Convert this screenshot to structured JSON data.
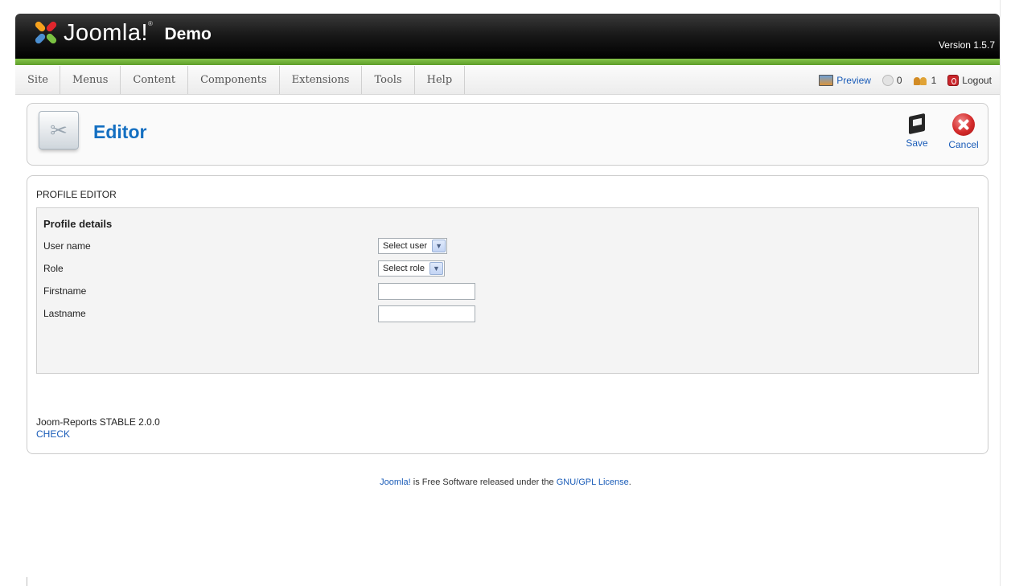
{
  "header": {
    "brand": "Joomla!",
    "brand_tm": "®",
    "site_name": "Demo",
    "version": "Version 1.5.7"
  },
  "menu": {
    "items": [
      {
        "label": "Site"
      },
      {
        "label": "Menus"
      },
      {
        "label": "Content"
      },
      {
        "label": "Components"
      },
      {
        "label": "Extensions"
      },
      {
        "label": "Tools"
      },
      {
        "label": "Help"
      }
    ]
  },
  "status": {
    "preview_label": "Preview",
    "messages_count": "0",
    "users_count": "1",
    "logout_label": "Logout"
  },
  "toolbar": {
    "title": "Editor",
    "save_label": "Save",
    "cancel_label": "Cancel"
  },
  "content": {
    "section_title": "PROFILE EDITOR",
    "fieldset_legend": "Profile details",
    "fields": {
      "username_label": "User name",
      "username_value": "Select user",
      "role_label": "Role",
      "role_value": "Select role",
      "firstname_label": "Firstname",
      "firstname_value": "",
      "lastname_label": "Lastname",
      "lastname_value": ""
    },
    "version_info": "Joom-Reports STABLE 2.0.0",
    "check_link": "CHECK"
  },
  "footer": {
    "joomla_link": "Joomla!",
    "text_middle": " is Free Software released under the ",
    "license_link": "GNU/GPL License",
    "text_end": "."
  },
  "colors": {
    "accent_blue": "#146fc1",
    "header_green": "#86c44a",
    "header_black": "#000000"
  }
}
